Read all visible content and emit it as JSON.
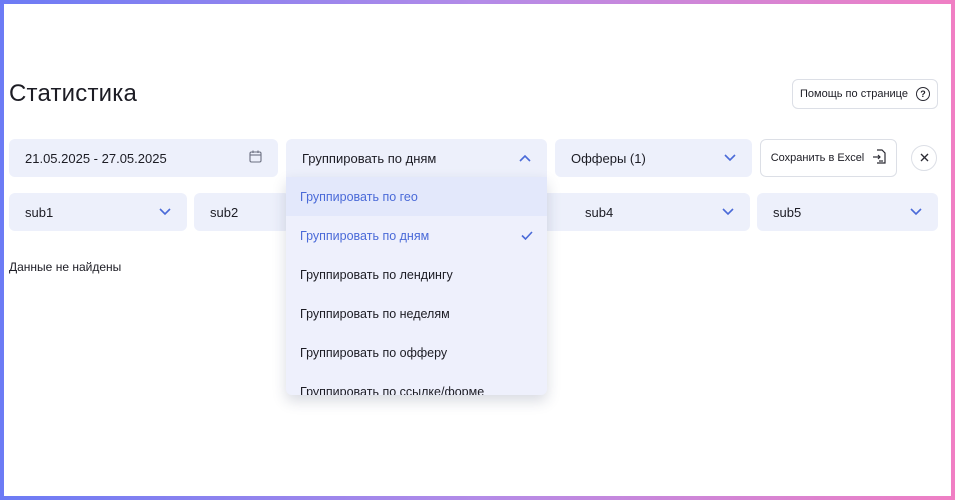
{
  "page": {
    "title": "Статистика",
    "help_label": "Помощь по странице",
    "empty_text": "Данные не найдены"
  },
  "filters": {
    "date_range": "21.05.2025 - 27.05.2025",
    "group_by": "Группировать по дням",
    "offers": "Офферы (1)",
    "export_label": "Сохранить в Excel"
  },
  "subs": [
    "sub1",
    "sub2",
    "sub4",
    "sub5"
  ],
  "group_menu": {
    "items": [
      "Группировать по гео",
      "Группировать по дням",
      "Группировать по лендингу",
      "Группировать по неделям",
      "Группировать по офферу",
      "Группировать по ссылке/форме"
    ],
    "selected": "Группировать по дням",
    "hovered": "Группировать по гео"
  },
  "colors": {
    "accent": "#4a6ad8",
    "field_bg": "#edf0fb",
    "text": "#1c1c24"
  }
}
